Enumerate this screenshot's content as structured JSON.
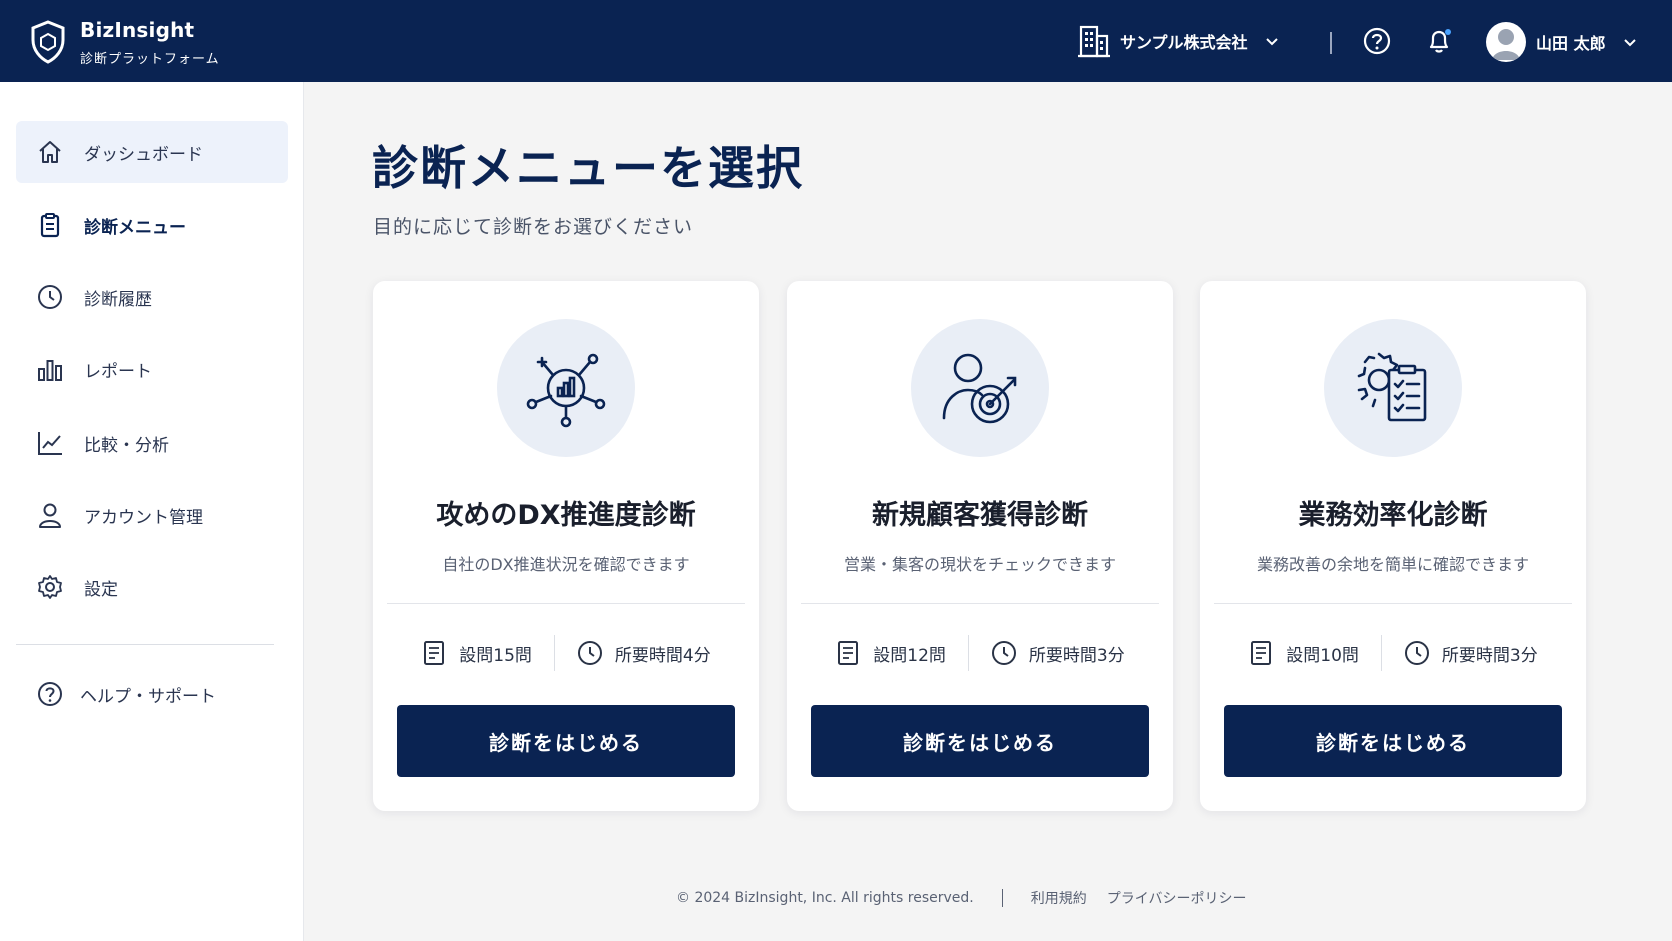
{
  "header": {
    "brand_name": "BizInsight",
    "brand_sub": "診断プラットフォーム",
    "company_name": "サンプル株式会社",
    "user_name": "山田 太郎"
  },
  "sidebar": {
    "items": [
      {
        "label": "ダッシュボード",
        "icon": "home-icon"
      },
      {
        "label": "診断メニュー",
        "icon": "clipboard-icon"
      },
      {
        "label": "診断履歴",
        "icon": "clock-icon"
      },
      {
        "label": "レポート",
        "icon": "bar-chart-icon"
      },
      {
        "label": "比較・分析",
        "icon": "line-chart-icon"
      },
      {
        "label": "アカウント管理",
        "icon": "user-icon"
      },
      {
        "label": "設定",
        "icon": "gear-icon"
      }
    ],
    "help_label": "ヘルプ・サポート"
  },
  "main": {
    "title": "診断メニューを選択",
    "subtitle": "目的に応じて診断をお選びください",
    "cards": [
      {
        "title": "攻めのDX推進度診断",
        "description": "自社のDX推進状況を確認できます",
        "questions": "設問15問",
        "duration": "所要時間4分",
        "button": "診断をはじめる",
        "icon": "network-analytics-icon"
      },
      {
        "title": "新規顧客獲得診断",
        "description": "営業・集客の現状をチェックできます",
        "questions": "設問12問",
        "duration": "所要時間3分",
        "button": "診断をはじめる",
        "icon": "person-target-icon"
      },
      {
        "title": "業務効率化診断",
        "description": "業務改善の余地を簡単に確認できます",
        "questions": "設問10問",
        "duration": "所要時間3分",
        "button": "診断をはじめる",
        "icon": "gear-checklist-icon"
      }
    ]
  },
  "footer": {
    "copyright": "© 2024 BizInsight, Inc. All rights reserved.",
    "terms": "利用規約",
    "privacy": "プライバシーポリシー"
  },
  "colors": {
    "navy": "#0a2352",
    "active_bg": "#edf2fb",
    "icon_circle": "#e9eef6",
    "notification_dot": "#4aa3ff"
  }
}
